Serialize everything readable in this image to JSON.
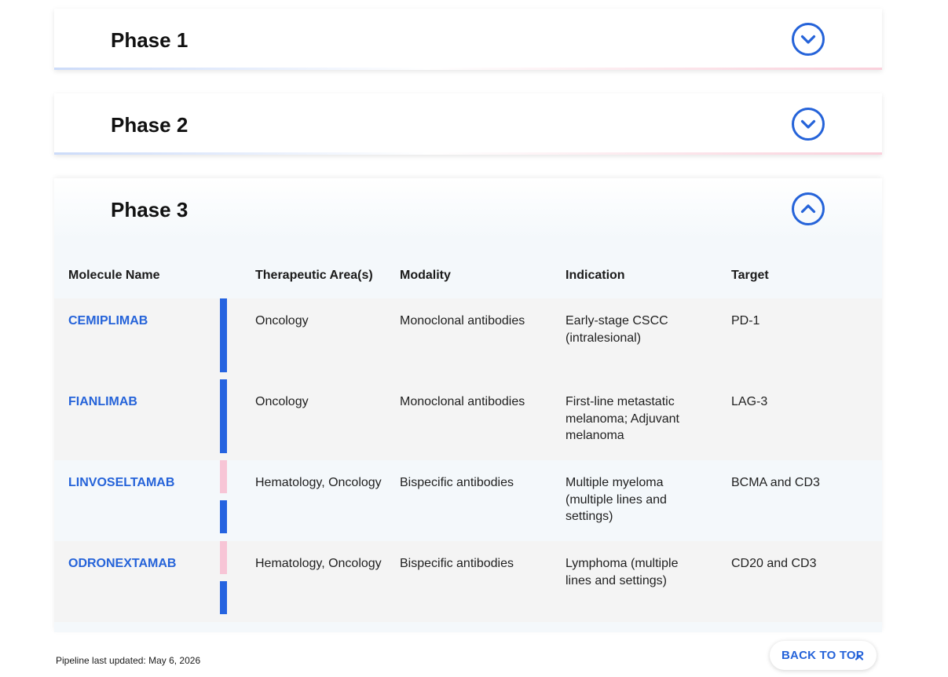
{
  "phases": [
    {
      "title": "Phase 1",
      "state": "collapsed"
    },
    {
      "title": "Phase 2",
      "state": "collapsed"
    },
    {
      "title": "Phase 3",
      "state": "expanded"
    }
  ],
  "table": {
    "headers": {
      "molecule": "Molecule Name",
      "area": "Therapeutic Area(s)",
      "modality": "Modality",
      "indication": "Indication",
      "target": "Target"
    },
    "rows": [
      {
        "molecule": "CEMIPLIMAB",
        "area": "Oncology",
        "modality": "Monoclonal antibodies",
        "indication": "Early-stage CSCC (intralesional)",
        "target": "PD-1"
      },
      {
        "molecule": "FIANLIMAB",
        "area": "Oncology",
        "modality": "Monoclonal antibodies",
        "indication": "First-line metastatic melanoma; Adjuvant melanoma",
        "target": "LAG-3"
      },
      {
        "molecule": "LINVOSELTAMAB",
        "area": "Hematology, Oncology",
        "modality": "Bispecific antibodies",
        "indication": "Multiple myeloma (multiple lines and settings)",
        "target": "BCMA and CD3"
      },
      {
        "molecule": "ODRONEXTAMAB",
        "area": "Hematology, Oncology",
        "modality": "Bispecific antibodies",
        "indication": "Lymphoma (multiple lines and settings)",
        "target": "CD20 and CD3"
      }
    ]
  },
  "footer": {
    "note": "Pipeline last updated: May 6, 2026",
    "back_to_top": "BACK TO TOP"
  },
  "colors": {
    "accent_blue": "#2563d9",
    "oncology_bar": "#2563e0",
    "hematology_bar": "#f7c5d6"
  },
  "icons": {
    "collapsed_toggle": "chevron-down-circle-icon",
    "expanded_toggle": "chevron-up-circle-icon",
    "back_to_top": "chevron-up-icon"
  }
}
